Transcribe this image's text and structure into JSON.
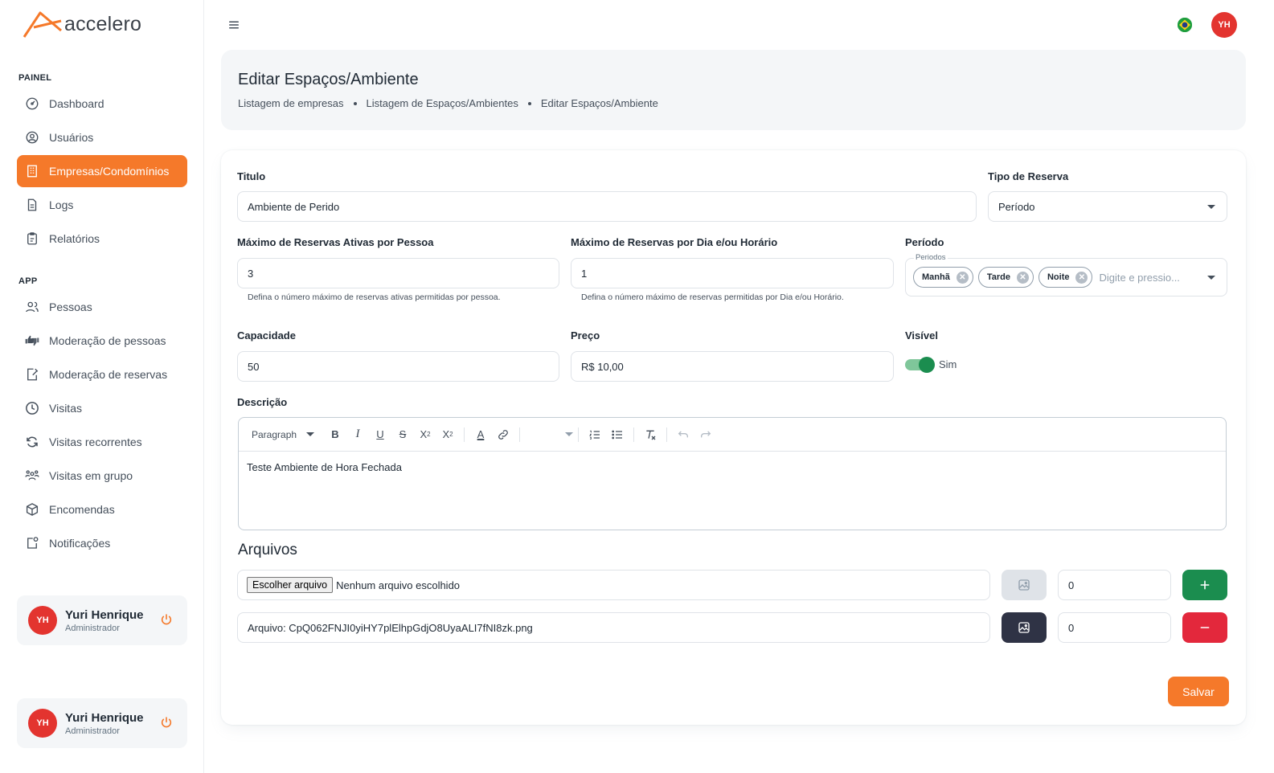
{
  "brand": {
    "name": "accelero",
    "accent": "#f5792a"
  },
  "sidebar": {
    "sections": [
      {
        "label": "PAINEL",
        "items": [
          {
            "label": "Dashboard",
            "icon": "dashboard-icon",
            "active": false
          },
          {
            "label": "Usuários",
            "icon": "user-circle-icon",
            "active": false
          },
          {
            "label": "Empresas/Condomínios",
            "icon": "building-icon",
            "active": true
          },
          {
            "label": "Logs",
            "icon": "file-icon",
            "active": false
          },
          {
            "label": "Relatórios",
            "icon": "clipboard-icon",
            "active": false
          }
        ]
      },
      {
        "label": "APP",
        "items": [
          {
            "label": "Pessoas",
            "icon": "people-icon",
            "active": false
          },
          {
            "label": "Moderação de pessoas",
            "icon": "thumbs-icon",
            "active": false
          },
          {
            "label": "Moderação de reservas",
            "icon": "calendar-edit-icon",
            "active": false
          },
          {
            "label": "Visitas",
            "icon": "clock-icon",
            "active": false
          },
          {
            "label": "Visitas recorrentes",
            "icon": "refresh-icon",
            "active": false
          },
          {
            "label": "Visitas em grupo",
            "icon": "group-icon",
            "active": false
          },
          {
            "label": "Encomendas",
            "icon": "package-icon",
            "active": false
          },
          {
            "label": "Notificações",
            "icon": "notification-icon",
            "active": false
          }
        ]
      }
    ],
    "user_cards": [
      {
        "initials": "YH",
        "name": "Yuri Henrique",
        "role": "Administrador"
      },
      {
        "initials": "YH",
        "name": "Yuri Henrique",
        "role": "Administrador"
      }
    ]
  },
  "topbar": {
    "avatar_initials": "YH"
  },
  "header": {
    "title": "Editar Espaços/Ambiente",
    "breadcrumbs": [
      "Listagem de empresas",
      "Listagem de Espaços/Ambientes",
      "Editar Espaços/Ambiente"
    ]
  },
  "form": {
    "titulo": {
      "label": "Titulo",
      "value": "Ambiente de Perido"
    },
    "tipo_reserva": {
      "label": "Tipo de Reserva",
      "value": "Período"
    },
    "max_ativas": {
      "label": "Máximo de Reservas Ativas por Pessoa",
      "value": "3",
      "helper": "Defina o número máximo de reservas ativas permitidas por pessoa."
    },
    "max_dia": {
      "label": "Máximo de Reservas por Dia e/ou Horário",
      "value": "1",
      "helper": "Defina o número máximo de reservas permitidas por Dia e/ou Horário."
    },
    "periodo": {
      "label": "Período",
      "float_label": "Periodos",
      "chips": [
        "Manhã",
        "Tarde",
        "Noite"
      ],
      "placeholder": "Digite e pressio..."
    },
    "capacidade": {
      "label": "Capacidade",
      "value": "50"
    },
    "preco": {
      "label": "Preço",
      "value": "R$ 10,00"
    },
    "visivel": {
      "label": "Visível",
      "value": "Sim",
      "on": true
    },
    "descricao": {
      "label": "Descrição",
      "block_format": "Paragraph",
      "content": "Teste Ambiente de Hora Fechada"
    },
    "arquivos": {
      "title": "Arquivos",
      "rows": [
        {
          "file_button": "Escolher arquivo",
          "file_text": "Nenhum arquivo escolhido",
          "order": "0",
          "action": "add"
        },
        {
          "file_text": "Arquivo: CpQ062FNJI0yiHY7plElhpGdjO8UyaALI7fNI8zk.png",
          "order": "0",
          "action": "remove"
        }
      ]
    },
    "save_label": "Salvar"
  }
}
